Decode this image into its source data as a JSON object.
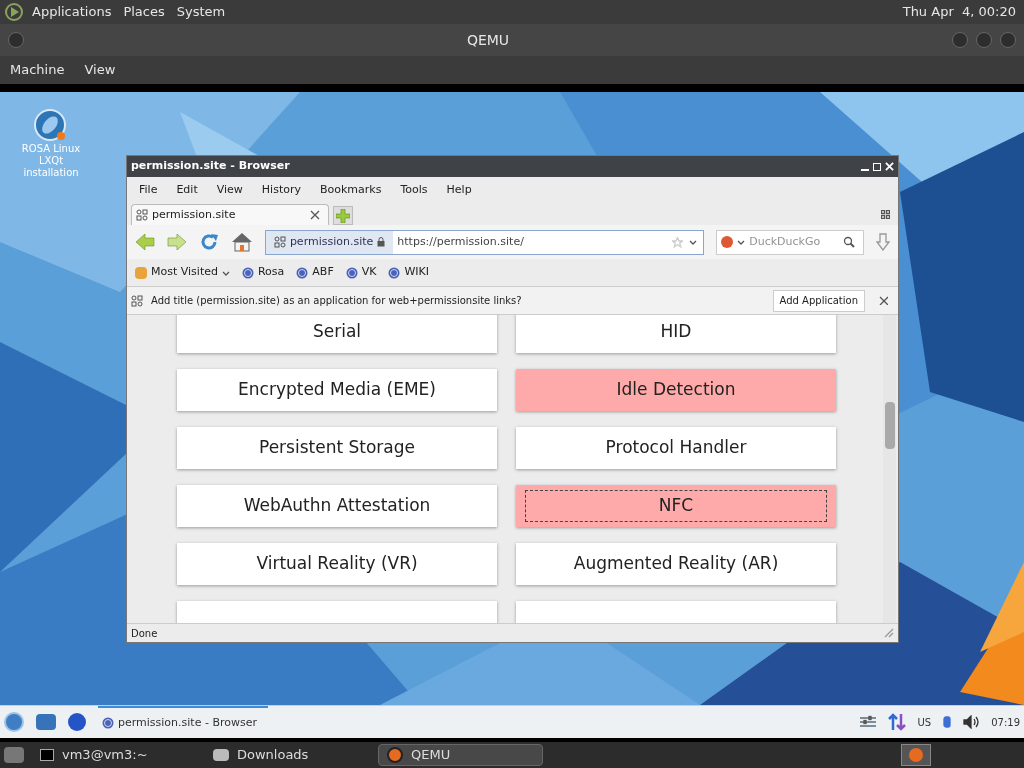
{
  "top_panel": {
    "menus": [
      "Applications",
      "Places",
      "System"
    ],
    "clock": "Thu Apr  4, 00:20"
  },
  "qemu": {
    "title": "QEMU",
    "menus": [
      "Machine",
      "View"
    ]
  },
  "desktop_icons": [
    {
      "label": "ROSA Linux LXQt installation"
    }
  ],
  "browser": {
    "title": "permission.site - Browser",
    "menus": [
      "File",
      "Edit",
      "View",
      "History",
      "Bookmarks",
      "Tools",
      "Help"
    ],
    "tabs": [
      {
        "label": "permission.site",
        "selected": true
      }
    ],
    "site_badge": "permission.site",
    "url": "https://permission.site/",
    "search_placeholder": "DuckDuckGo",
    "bookmarks": [
      {
        "label": "Most Visited",
        "kind": "folder"
      },
      {
        "label": "Rosa",
        "kind": "link"
      },
      {
        "label": "ABF",
        "kind": "link"
      },
      {
        "label": "VK",
        "kind": "link"
      },
      {
        "label": "WIKI",
        "kind": "link"
      }
    ],
    "notification": {
      "text": "Add title (permission.site) as an application for web+permissionsite links?",
      "button": "Add Application"
    },
    "permissions": [
      {
        "label": "Serial",
        "highlighted": false,
        "focused": false
      },
      {
        "label": "HID",
        "highlighted": false,
        "focused": false
      },
      {
        "label": "Encrypted Media (EME)",
        "highlighted": false,
        "focused": false
      },
      {
        "label": "Idle Detection",
        "highlighted": true,
        "focused": false
      },
      {
        "label": "Persistent Storage",
        "highlighted": false,
        "focused": false
      },
      {
        "label": "Protocol Handler",
        "highlighted": false,
        "focused": false
      },
      {
        "label": "WebAuthn Attestation",
        "highlighted": false,
        "focused": false
      },
      {
        "label": "NFC",
        "highlighted": true,
        "focused": true
      },
      {
        "label": "Virtual Reality (VR)",
        "highlighted": false,
        "focused": false
      },
      {
        "label": "Augmented Reality (AR)",
        "highlighted": false,
        "focused": false
      }
    ],
    "status": "Done"
  },
  "vm_taskbar": {
    "task": "permission.site - Browser",
    "keyboard": "US",
    "clock": "07:19"
  },
  "host_taskbar": {
    "items": [
      {
        "label": "vm3@vm3:~",
        "selected": false,
        "kind": "terminal"
      },
      {
        "label": "Downloads",
        "selected": false,
        "kind": "folder"
      },
      {
        "label": "QEMU",
        "selected": true,
        "kind": "app"
      }
    ]
  }
}
